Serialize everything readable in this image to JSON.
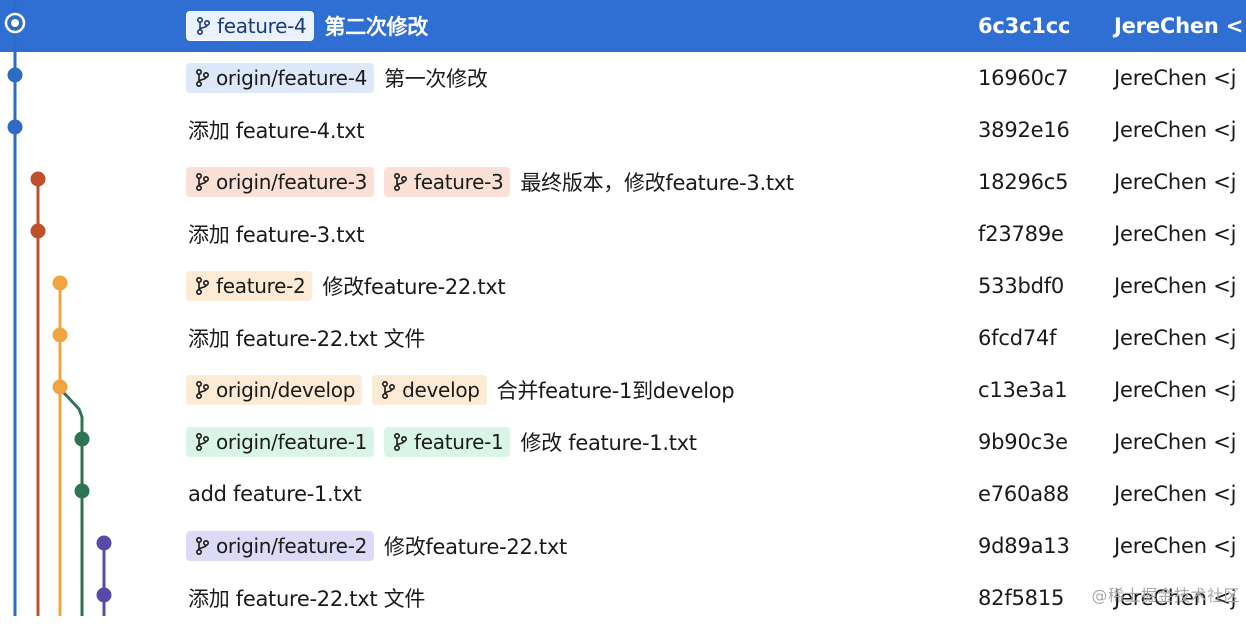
{
  "lanes": [
    {
      "color": "#2d6bc4"
    },
    {
      "color": "#c0502c"
    },
    {
      "color": "#f0a640"
    },
    {
      "color": "#2e7352"
    },
    {
      "color": "#5a4aa8"
    }
  ],
  "commits": [
    {
      "lane": 0,
      "selected": true,
      "refs": [
        {
          "label": "feature-4",
          "bg": "#eaf2ff",
          "fg": "#1a3a7a"
        }
      ],
      "message": "第二次修改",
      "hash": "6c3c1cc",
      "author": "JereChen <"
    },
    {
      "lane": 0,
      "refs": [
        {
          "label": "origin/feature-4",
          "bg": "#dde9fb",
          "fg": "#1a1a1a"
        }
      ],
      "message": "第一次修改",
      "hash": "16960c7",
      "author": "JereChen <j"
    },
    {
      "lane": 0,
      "refs": [],
      "message": "添加 feature-4.txt",
      "hash": "3892e16",
      "author": "JereChen <j"
    },
    {
      "lane": 1,
      "refs": [
        {
          "label": "origin/feature-3",
          "bg": "#fbe0d6",
          "fg": "#1a1a1a"
        },
        {
          "label": "feature-3",
          "bg": "#fbe0d6",
          "fg": "#1a1a1a"
        }
      ],
      "message": "最终版本，修改feature-3.txt",
      "hash": "18296c5",
      "author": "JereChen <j"
    },
    {
      "lane": 1,
      "refs": [],
      "message": "添加 feature-3.txt",
      "hash": "f23789e",
      "author": "JereChen <j"
    },
    {
      "lane": 2,
      "refs": [
        {
          "label": "feature-2",
          "bg": "#fdebd6",
          "fg": "#1a1a1a"
        }
      ],
      "message": "修改feature-22.txt",
      "hash": "533bdf0",
      "author": "JereChen <j"
    },
    {
      "lane": 2,
      "refs": [],
      "message": "添加 feature-22.txt 文件",
      "hash": "6fcd74f",
      "author": "JereChen <j"
    },
    {
      "lane": 2,
      "merge": 3,
      "refs": [
        {
          "label": "origin/develop",
          "bg": "#fdebd6",
          "fg": "#1a1a1a"
        },
        {
          "label": "develop",
          "bg": "#fdebd6",
          "fg": "#1a1a1a"
        }
      ],
      "message": "合并feature-1到develop",
      "hash": "c13e3a1",
      "author": "JereChen <j"
    },
    {
      "lane": 3,
      "refs": [
        {
          "label": "origin/feature-1",
          "bg": "#d9f5e8",
          "fg": "#1a1a1a"
        },
        {
          "label": "feature-1",
          "bg": "#d9f5e8",
          "fg": "#1a1a1a"
        }
      ],
      "message": "修改 feature-1.txt",
      "hash": "9b90c3e",
      "author": "JereChen <j"
    },
    {
      "lane": 3,
      "refs": [],
      "message": "add feature-1.txt",
      "hash": "e760a88",
      "author": "JereChen <j"
    },
    {
      "lane": 4,
      "refs": [
        {
          "label": "origin/feature-2",
          "bg": "#dcdaf6",
          "fg": "#1a1a1a"
        }
      ],
      "message": "修改feature-22.txt",
      "hash": "9d89a13",
      "author": "JereChen <j"
    },
    {
      "lane": 4,
      "refs": [],
      "message": "添加 feature-22.txt 文件",
      "hash": "82f5815",
      "author": "JereChen <j"
    }
  ],
  "branch_icon": "git-branch-icon",
  "watermark": "@稀土掘金技术社区"
}
